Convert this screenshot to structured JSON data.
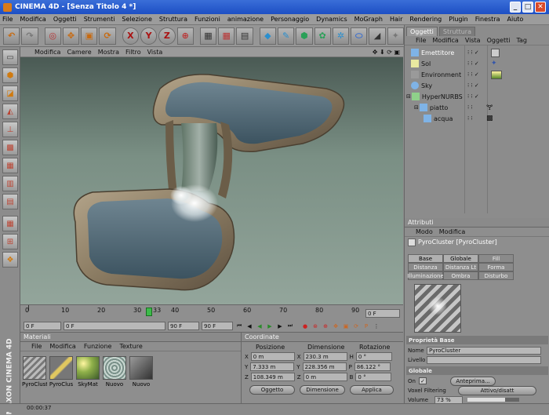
{
  "window": {
    "title": "CINEMA 4D - [Senza Titolo 4 *]",
    "minimize": "_",
    "maximize": "□",
    "close": "✕"
  },
  "menu": [
    "File",
    "Modifica",
    "Oggetti",
    "Strumenti",
    "Selezione",
    "Struttura",
    "Funzioni",
    "animazione",
    "Personaggio",
    "Dynamics",
    "MoGraph",
    "Hair",
    "Rendering",
    "Plugin",
    "Finestra",
    "Aiuto"
  ],
  "toolbar": {
    "axis_x": "X",
    "axis_y": "Y",
    "axis_z": "Z"
  },
  "viewport": {
    "menu": [
      "Modifica",
      "Camere",
      "Mostra",
      "Filtro",
      "Vista"
    ],
    "nav_icons": "✥ ⬇ ⟳ ▣"
  },
  "timeline": {
    "ticks": [
      "0",
      "10",
      "20",
      "30",
      "33",
      "40",
      "50",
      "60",
      "70",
      "80",
      "90"
    ],
    "end_frame": "0 F",
    "current_frame_marker": 33
  },
  "transport": {
    "start": "0 F",
    "min": "0 F",
    "max": "90 F",
    "end": "90 F"
  },
  "materials": {
    "title": "Materiali",
    "menu": [
      "File",
      "Modifica",
      "Funzione",
      "Texture"
    ],
    "items": [
      {
        "label": "PyroClust",
        "color": "#9a9a9a"
      },
      {
        "label": "PyroClus",
        "color": "#c9b56a"
      },
      {
        "label": "SkyMat",
        "color": "#7fa24d"
      },
      {
        "label": "Nuovo",
        "color": "#9ab0a8"
      },
      {
        "label": "Nuovo",
        "color": "#5a5a5a"
      }
    ]
  },
  "coordinates": {
    "title": "Coordinate",
    "headers": [
      "Posizione",
      "Dimensione",
      "Rotazione"
    ],
    "rows": [
      {
        "axis": "X",
        "pos": "0 m",
        "dim": "230.3 m",
        "rot_label": "H",
        "rot": "0 °"
      },
      {
        "axis": "Y",
        "pos": "7.333 m",
        "dim": "228.356 m",
        "rot_label": "P",
        "rot": "86.122 °"
      },
      {
        "axis": "Z",
        "pos": "108.349 m",
        "dim": "0 m",
        "rot_label": "B",
        "rot": "0 °"
      }
    ],
    "mode_left": "Oggetto",
    "mode_right": "Dimensione",
    "apply": "Applica"
  },
  "object_manager": {
    "tabs": [
      "Oggetti",
      "Struttura"
    ],
    "menu": [
      "File",
      "Modifica",
      "Vista",
      "Oggetti",
      "Tag"
    ],
    "objects": [
      {
        "name": "Emettitore",
        "indent": 0,
        "icon": "emitter-icon",
        "color": "#7fb3e6"
      },
      {
        "name": "Sol",
        "indent": 0,
        "icon": "light-icon",
        "color": "#e8e8a0"
      },
      {
        "name": "Environment",
        "indent": 0,
        "icon": "environment-icon",
        "color": "#9a9a9a"
      },
      {
        "name": "Sky",
        "indent": 0,
        "icon": "sky-icon",
        "color": "#7fb3e6"
      },
      {
        "name": "HyperNURBS",
        "indent": 0,
        "icon": "hypernurbs-icon",
        "color": "#8fd08a"
      },
      {
        "name": "piatto",
        "indent": 1,
        "icon": "polygon-icon",
        "color": "#7fb3e6"
      },
      {
        "name": "acqua",
        "indent": 2,
        "icon": "polygon-icon",
        "color": "#7fb3e6"
      }
    ]
  },
  "attributes": {
    "title": "Attributi",
    "menu": [
      "Modo",
      "Modifica"
    ],
    "object_label": "PyroCluster [PyroCluster]",
    "tabs": [
      "Base",
      "Globale",
      "Fill",
      "Distanza",
      "Distanza Lt",
      "Forma",
      "Illuminazione",
      "Ombra",
      "Disturbo"
    ],
    "section_basic": "Proprietà Base",
    "name_label": "Nome",
    "name_value": "PyroCluster",
    "layer_label": "Livello",
    "section_global": "Globale",
    "preview_label": "Anteprima...",
    "smoothing_label": "Voxel Filtering",
    "smoothing_value": "Attivo/disatt",
    "volume_label": "Volume",
    "volume_value": "73 %",
    "on_label": "On"
  },
  "status": {
    "time": "00:00:37"
  },
  "logo": "MAXON CINEMA 4D"
}
